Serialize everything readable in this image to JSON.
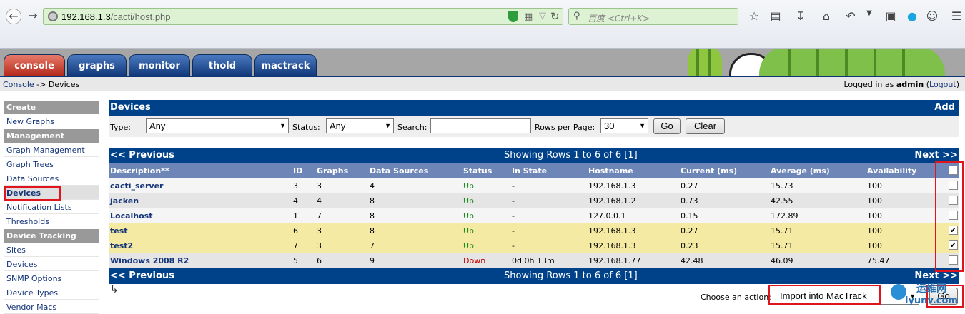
{
  "browser": {
    "url_host": "192.168.1.3",
    "url_path": "/cacti/host.php",
    "search_placeholder": "百度 <Ctrl+K>"
  },
  "tabs": [
    {
      "label": "console",
      "active": true
    },
    {
      "label": "graphs",
      "active": false
    },
    {
      "label": "monitor",
      "active": false
    },
    {
      "label": "thold",
      "active": false
    },
    {
      "label": "mactrack",
      "active": false
    }
  ],
  "breadcrumb": {
    "root": "Console",
    "sep": " -> ",
    "current": "Devices"
  },
  "login": {
    "prefix": "Logged in as ",
    "user": "admin",
    "logout": "Logout"
  },
  "sidebar": {
    "create_head": "Create",
    "new_graphs": "New Graphs",
    "management_head": "Management",
    "graph_management": "Graph Management",
    "graph_trees": "Graph Trees",
    "data_sources": "Data Sources",
    "devices": "Devices",
    "notification_lists": "Notification Lists",
    "thresholds": "Thresholds",
    "device_tracking_head": "Device Tracking",
    "sites": "Sites",
    "devices2": "Devices",
    "snmp_options": "SNMP Options",
    "device_types": "Device Types",
    "vendor_macs": "Vendor Macs"
  },
  "panel": {
    "title": "Devices",
    "add": "Add"
  },
  "filter": {
    "type_label": "Type:",
    "type_value": "Any",
    "status_label": "Status:",
    "status_value": "Any",
    "search_label": "Search:",
    "search_value": "",
    "rows_label": "Rows per Page:",
    "rows_value": "30",
    "go": "Go",
    "clear": "Clear"
  },
  "pager": {
    "previous": "<< Previous",
    "showing": "Showing Rows 1 to 6 of 6 [1]",
    "next": "Next >>"
  },
  "table": {
    "headers": [
      "Description**",
      "ID",
      "Graphs",
      "Data Sources",
      "Status",
      "In State",
      "Hostname",
      "Current (ms)",
      "Average (ms)",
      "Availability"
    ],
    "rows": [
      {
        "desc": "cacti_server",
        "id": "3",
        "graphs": "3",
        "ds": "4",
        "status": "Up",
        "instate": "-",
        "host": "192.168.1.3",
        "cur": "0.27",
        "avg": "15.73",
        "avail": "100",
        "checked": false,
        "hl": false
      },
      {
        "desc": "jacken",
        "id": "4",
        "graphs": "4",
        "ds": "8",
        "status": "Up",
        "instate": "-",
        "host": "192.168.1.2",
        "cur": "0.73",
        "avg": "42.55",
        "avail": "100",
        "checked": false,
        "hl": false
      },
      {
        "desc": "Localhost",
        "id": "1",
        "graphs": "7",
        "ds": "8",
        "status": "Up",
        "instate": "-",
        "host": "127.0.0.1",
        "cur": "0.15",
        "avg": "172.89",
        "avail": "100",
        "checked": false,
        "hl": false
      },
      {
        "desc": "test",
        "id": "6",
        "graphs": "3",
        "ds": "8",
        "status": "Up",
        "instate": "-",
        "host": "192.168.1.3",
        "cur": "0.27",
        "avg": "15.71",
        "avail": "100",
        "checked": true,
        "hl": true
      },
      {
        "desc": "test2",
        "id": "7",
        "graphs": "3",
        "ds": "7",
        "status": "Up",
        "instate": "-",
        "host": "192.168.1.3",
        "cur": "0.23",
        "avg": "15.71",
        "avail": "100",
        "checked": true,
        "hl": true
      },
      {
        "desc": "Windows 2008 R2",
        "id": "5",
        "graphs": "6",
        "ds": "9",
        "status": "Down",
        "instate": "0d 0h 13m",
        "host": "192.168.1.77",
        "cur": "42.48",
        "avg": "46.09",
        "avail": "75.47",
        "checked": false,
        "hl": false
      }
    ]
  },
  "action": {
    "label": "Choose an action:",
    "value": "Import into MacTrack",
    "go": "Go"
  },
  "watermark": {
    "line1": "运维网",
    "line2": "iyunv.com"
  }
}
